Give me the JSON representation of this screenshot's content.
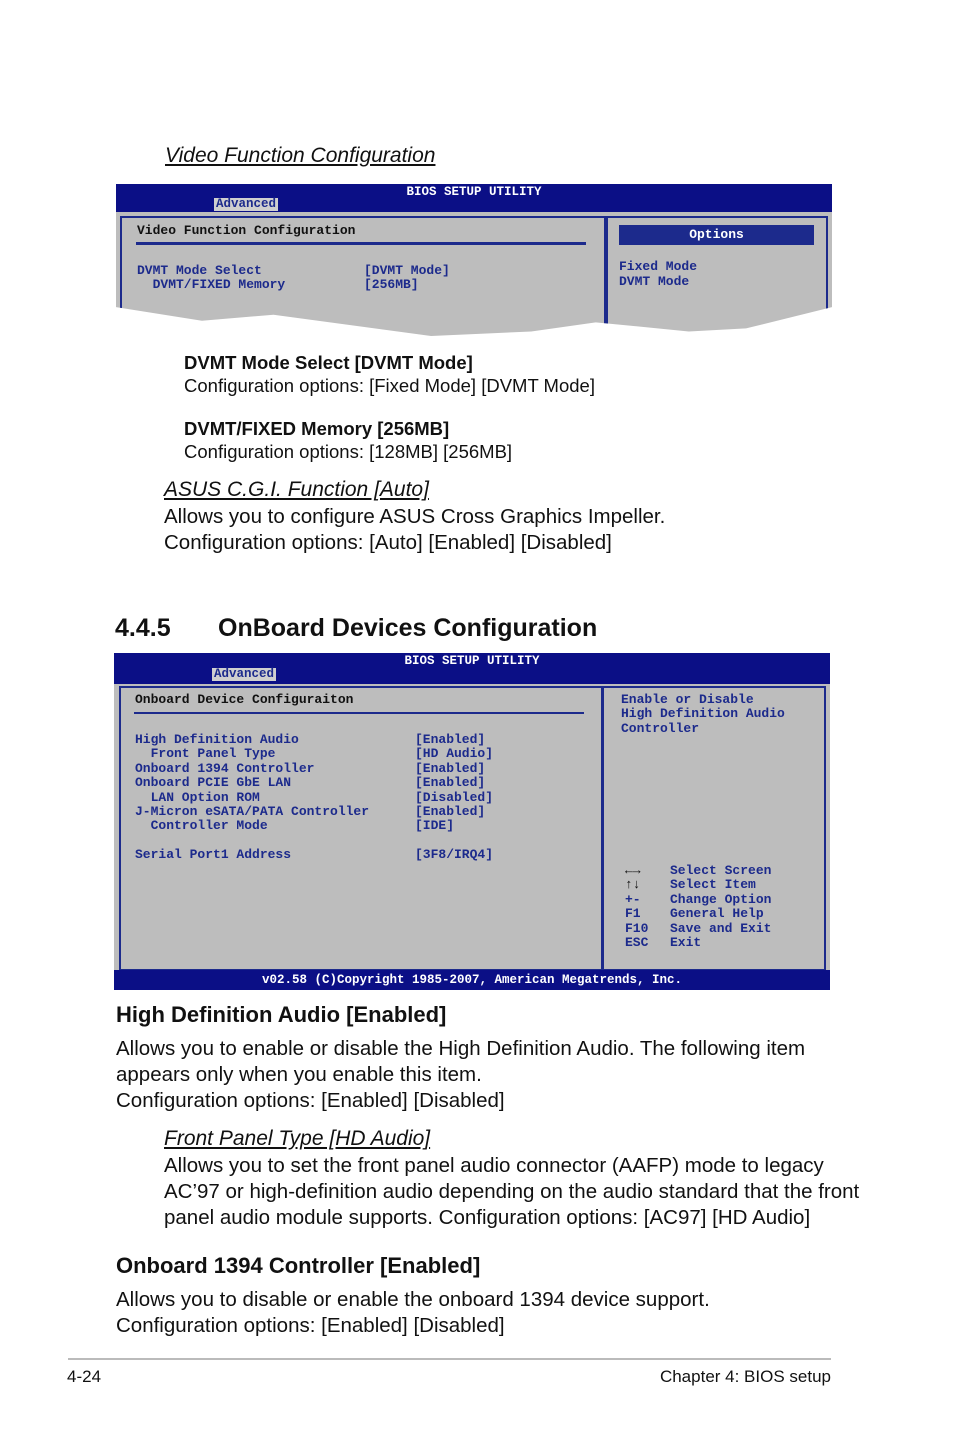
{
  "video_section": {
    "title": "Video Function Configuration"
  },
  "bios1": {
    "header": "BIOS SETUP UTILITY",
    "tab": "Advanced",
    "panel_title": "Video Function Configuration",
    "items": [
      {
        "label": "DVMT Mode Select",
        "value": "[DVMT Mode]"
      },
      {
        "label": "  DVMT/FIXED Memory",
        "value": "[256MB]"
      }
    ],
    "options_title": "Options",
    "options": [
      "Fixed Mode",
      "DVMT Mode"
    ]
  },
  "dvmt_mode": {
    "title": "DVMT Mode Select [DVMT Mode]",
    "desc": "Configuration options: [Fixed Mode] [DVMT Mode]"
  },
  "dvmt_mem": {
    "title": "DVMT/FIXED Memory [256MB]",
    "desc": "Configuration options: [128MB] [256MB]"
  },
  "cgi": {
    "title": "ASUS C.G.I. Function [Auto]",
    "desc1": "Allows you to configure ASUS Cross Graphics Impeller.",
    "desc2": "Configuration options: [Auto] [Enabled] [Disabled]"
  },
  "section": {
    "number": "4.4.5",
    "title": "OnBoard Devices Configuration"
  },
  "bios2": {
    "header": "BIOS SETUP UTILITY",
    "tab": "Advanced",
    "panel_title": "Onboard Device Configuraiton",
    "items": [
      {
        "label": "High Definition Audio",
        "value": "[Enabled]"
      },
      {
        "label": "  Front Panel Type",
        "value": "[HD Audio]"
      },
      {
        "label": "Onboard 1394 Controller",
        "value": "[Enabled]"
      },
      {
        "label": "Onboard PCIE GbE LAN",
        "value": "[Enabled]"
      },
      {
        "label": "  LAN Option ROM",
        "value": "[Disabled]"
      },
      {
        "label": "J-Micron eSATA/PATA Controller",
        "value": "[Enabled]"
      },
      {
        "label": "  Controller Mode",
        "value": "[IDE]"
      },
      {
        "label": "",
        "value": ""
      },
      {
        "label": "Serial Port1 Address",
        "value": "[3F8/IRQ4]"
      }
    ],
    "help": [
      "Enable or Disable",
      "High Definition Audio",
      "Controller"
    ],
    "keys": [
      {
        "key": "←→",
        "action": "Select Screen"
      },
      {
        "key": "↑↓",
        "action": "Select Item"
      },
      {
        "key": "+-",
        "action": "Change Option"
      },
      {
        "key": "F1",
        "action": "General Help"
      },
      {
        "key": "F10",
        "action": "Save and Exit"
      },
      {
        "key": "ESC",
        "action": "Exit"
      }
    ],
    "footer": "v02.58 (C)Copyright 1985-2007, American Megatrends, Inc."
  },
  "hda": {
    "title": "High Definition Audio [Enabled]",
    "lines": [
      "Allows you to enable or disable the High Definition Audio. The following item",
      "appears only when you enable this item.",
      "Configuration options: [Enabled] [Disabled]"
    ]
  },
  "fpt": {
    "title": "Front Panel Type [HD Audio]",
    "lines": [
      "Allows you to set the front panel audio connector (AAFP) mode to legacy",
      "AC’97 or high-definition audio depending on the audio standard that the front",
      "panel audio module supports. Configuration options: [AC97] [HD Audio]"
    ]
  },
  "c1394": {
    "title": "Onboard 1394 Controller [Enabled]",
    "lines": [
      "Allows you to disable or enable the onboard 1394 device support.",
      "Configuration options: [Enabled] [Disabled]"
    ]
  },
  "page_footer": {
    "page": "4-24",
    "chapter": "Chapter 4: BIOS setup"
  }
}
